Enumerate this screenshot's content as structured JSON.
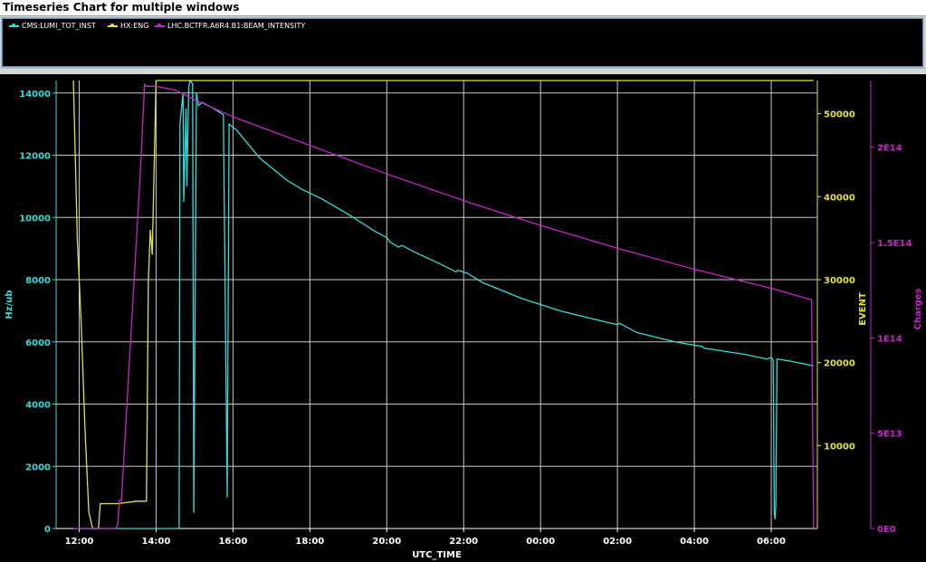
{
  "window": {
    "title": "Timeseries Chart for multiple windows"
  },
  "legend": [
    {
      "label": "CMS:LUMI_TOT_INST",
      "color": "#33dddd"
    },
    {
      "label": "HX:ENG",
      "color": "#e4e43a"
    },
    {
      "label": "LHC.BCTFR.A6R4.B1:BEAM_INTENSITY",
      "color": "#cc22cc"
    }
  ],
  "colors": {
    "background": "#000000",
    "grid": "#c8c8c8"
  },
  "chart_data": {
    "type": "line",
    "xlabel": "UTC_TIME",
    "x_unit": "hours since 12:00 UTC",
    "xlim": [
      -0.6,
      19.2
    ],
    "x_ticks": [
      {
        "v": 0,
        "label": "12:00"
      },
      {
        "v": 2,
        "label": "14:00"
      },
      {
        "v": 4,
        "label": "16:00"
      },
      {
        "v": 6,
        "label": "18:00"
      },
      {
        "v": 8,
        "label": "20:00"
      },
      {
        "v": 10,
        "label": "22:00"
      },
      {
        "v": 12,
        "label": "00:00"
      },
      {
        "v": 14,
        "label": "02:00"
      },
      {
        "v": 16,
        "label": "04:00"
      },
      {
        "v": 18,
        "label": "06:00"
      }
    ],
    "grid": true,
    "axes": {
      "left": {
        "label": "Hz/ub",
        "color": "#33dddd",
        "ylim": [
          0,
          14400
        ],
        "ticks": [
          "0",
          "2000",
          "4000",
          "6000",
          "8000",
          "10000",
          "12000",
          "14000"
        ],
        "tick_values": [
          0,
          2000,
          4000,
          6000,
          8000,
          10000,
          12000,
          14000
        ]
      },
      "right1": {
        "label": "EVENT",
        "color": "#e4e43a",
        "ylim": [
          0,
          54000
        ],
        "ticks": [
          "10000",
          "20000",
          "30000",
          "40000",
          "50000"
        ],
        "tick_values": [
          10000,
          20000,
          30000,
          40000,
          50000
        ]
      },
      "right2": {
        "label": "Charges",
        "color": "#cc22cc",
        "ylim": [
          0,
          235000000000000.0
        ],
        "ticks": [
          "0E0",
          "5E13",
          "1E14",
          "1.5E14",
          "2E14"
        ],
        "tick_values": [
          0,
          50000000000000.0,
          100000000000000.0,
          150000000000000.0,
          200000000000000.0
        ]
      }
    },
    "series": [
      {
        "name": "CMS:LUMI_TOT_INST",
        "axis": "left",
        "color": "#33dddd",
        "x": [
          -0.15,
          0.3,
          1.0,
          2.0,
          2.6,
          2.62,
          2.7,
          2.72,
          2.78,
          2.8,
          2.85,
          2.88,
          2.95,
          2.98,
          3.05,
          3.1,
          3.2,
          3.5,
          3.75,
          3.85,
          3.9,
          4.0,
          4.1,
          4.3,
          4.5,
          4.7,
          5.0,
          5.4,
          5.8,
          6.3,
          7.0,
          7.7,
          8.0,
          8.1,
          8.3,
          8.4,
          8.7,
          9.4,
          9.8,
          9.85,
          10.1,
          10.5,
          11.5,
          12.5,
          13.5,
          14.0,
          14.05,
          14.5,
          15.5,
          16.2,
          16.25,
          17.3,
          17.9,
          18.0,
          18.05,
          18.08,
          18.1,
          18.12,
          18.15,
          18.5,
          19.1
        ],
        "y": [
          0,
          0,
          0,
          0,
          0,
          13000,
          14000,
          10500,
          13500,
          11000,
          14200,
          14400,
          14300,
          500,
          14000,
          13600,
          13700,
          13500,
          13300,
          1000,
          13000,
          12900,
          12800,
          12500,
          12200,
          11900,
          11600,
          11200,
          10900,
          10600,
          10100,
          9550,
          9350,
          9200,
          9050,
          9100,
          8900,
          8500,
          8250,
          8300,
          8200,
          7900,
          7400,
          7000,
          6700,
          6550,
          6600,
          6300,
          6000,
          5850,
          5800,
          5600,
          5450,
          5500,
          5400,
          500,
          300,
          800,
          5450,
          5380,
          5230
        ]
      },
      {
        "name": "HX:ENG",
        "axis": "right1",
        "color": "#e4e43a",
        "x": [
          -0.15,
          -0.05,
          0.05,
          0.15,
          0.25,
          0.35,
          0.5,
          0.55,
          1.0,
          1.5,
          1.75,
          1.8,
          1.85,
          1.9,
          2.0,
          2.05,
          19.1
        ],
        "y": [
          54000,
          35000,
          25000,
          12000,
          2000,
          0,
          0,
          3000,
          3000,
          3300,
          3300,
          30000,
          36000,
          33000,
          54000,
          54000,
          54000
        ]
      },
      {
        "name": "LHC.BCTFR.A6R4.B1:BEAM_INTENSITY",
        "axis": "right2",
        "color": "#cc22cc",
        "x": [
          -0.15,
          0.5,
          0.95,
          1.0,
          1.05,
          1.1,
          1.6,
          1.7,
          1.75,
          1.8,
          2.0,
          2.5,
          3.0,
          4.0,
          6.0,
          8.0,
          10.0,
          12.0,
          14.0,
          16.0,
          18.0,
          19.05,
          19.1
        ],
        "y": [
          0,
          0,
          0,
          2000000000000.0,
          15000000000000.0,
          15000000000000.0,
          190000000000000.0,
          233000000000000.0,
          232000000000000.0,
          232000000000000.0,
          232000000000000.0,
          230000000000000.0,
          225000000000000.0,
          216000000000000.0,
          201000000000000.0,
          186000000000000.0,
          172000000000000.0,
          159000000000000.0,
          147000000000000.0,
          136000000000000.0,
          126000000000000.0,
          120000000000000.0,
          0
        ]
      }
    ]
  }
}
